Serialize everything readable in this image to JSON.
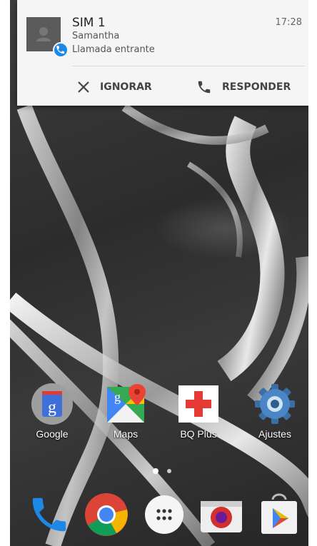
{
  "notification": {
    "title": "SIM 1",
    "time": "17:28",
    "caller": "Samantha",
    "subtitle": "Llamada entrante",
    "ignore_label": "IGNORAR",
    "answer_label": "RESPONDER"
  },
  "home": {
    "apps": [
      {
        "label": "Google",
        "icon": "google-search-icon"
      },
      {
        "label": "Maps",
        "icon": "maps-icon"
      },
      {
        "label": "BQ Plus",
        "icon": "bq-plus-icon"
      },
      {
        "label": "Ajustes",
        "icon": "settings-gear-icon"
      }
    ],
    "page_indicator": {
      "pages": 2,
      "current": 1
    }
  },
  "dock": [
    {
      "name": "Phone",
      "icon": "phone-icon"
    },
    {
      "name": "Chrome",
      "icon": "chrome-icon"
    },
    {
      "name": "Apps",
      "icon": "app-drawer-icon"
    },
    {
      "name": "Camera",
      "icon": "camera-icon"
    },
    {
      "name": "Play Store",
      "icon": "play-store-icon"
    }
  ],
  "colors": {
    "notification_bg": "#f5f5f5",
    "call_badge": "#1e88e5",
    "phone_blue": "#1e88e5"
  }
}
